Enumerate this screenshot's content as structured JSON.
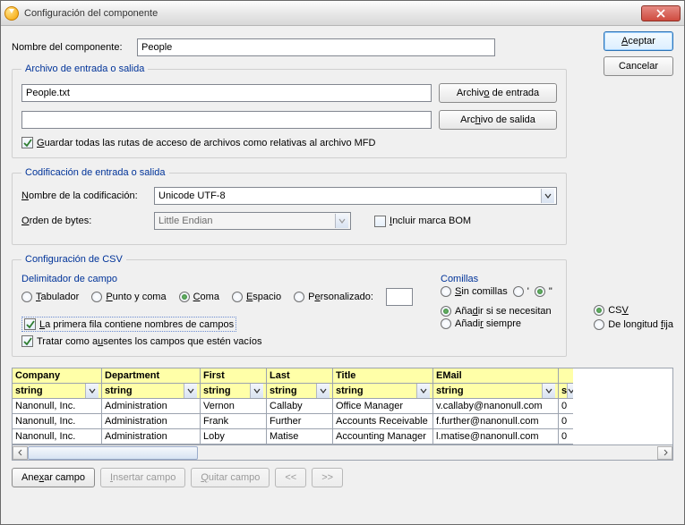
{
  "title": "Configuración del componente",
  "buttons": {
    "accept": "Aceptar",
    "cancel": "Cancelar",
    "inputFile": "Archivo de entrada",
    "outputFile": "Archivo de salida",
    "append": "Anexar campo",
    "insert": "Insertar campo",
    "remove": "Quitar campo",
    "left": "<<",
    "right": ">>"
  },
  "componentNameLabel": "Nombre del componente:",
  "componentName": "People",
  "fileGroup": "Archivo de entrada o salida",
  "inputPath": "People.txt",
  "outputPath": "",
  "saveRelative": "Guardar todas las rutas de acceso de archivos como relativas al archivo MFD",
  "encodingGroup": "Codificación de entrada o salida",
  "encodingNameLabel": "Nombre de la codificación:",
  "encodingName": "Unicode UTF-8",
  "byteOrderLabel": "Orden de bytes:",
  "byteOrder": "Little Endian",
  "includeBOM": "Incluir marca BOM",
  "csvGroup": "Configuración de CSV",
  "delimHeader": "Delimitador de campo",
  "delims": {
    "tab": "Tabulador",
    "semi": "Punto y coma",
    "comma": "Coma",
    "space": "Espacio",
    "custom": "Personalizado:",
    "customVal": ""
  },
  "firstRow": "La primera fila contiene nombres de campos",
  "treatEmpty": "Tratar como ausentes los campos que estén vacíos",
  "quotesHeader": "Comillas",
  "quotes": {
    "none": "Sin comillas",
    "single": "'",
    "double": "\"",
    "addIfNeeded": "Añadir si se necesitan",
    "always": "Añadir siempre"
  },
  "formatRadios": {
    "csv": "CSV",
    "fixed": "De longitud fija"
  },
  "table": {
    "headers": [
      "Company",
      "Department",
      "First",
      "Last",
      "Title",
      "EMail"
    ],
    "types": [
      "string",
      "string",
      "string",
      "string",
      "string",
      "string"
    ],
    "rows": [
      [
        "Nanonull, Inc.",
        "Administration",
        "Vernon",
        "Callaby",
        "Office Manager",
        "v.callaby@nanonull.com"
      ],
      [
        "Nanonull, Inc.",
        "Administration",
        "Frank",
        "Further",
        "Accounts Receivable",
        "f.further@nanonull.com"
      ],
      [
        "Nanonull, Inc.",
        "Administration",
        "Loby",
        "Matise",
        "Accounting Manager",
        "l.matise@nanonull.com"
      ]
    ],
    "extraCol": [
      "0",
      "0",
      "0"
    ]
  }
}
